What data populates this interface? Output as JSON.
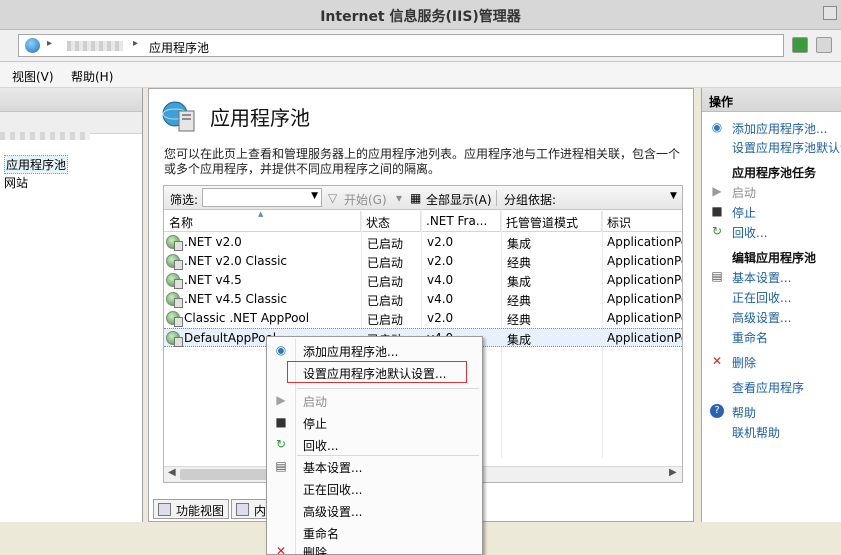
{
  "window": {
    "title": "Internet 信息服务(IIS)管理器"
  },
  "address": {
    "crumb": "应用程序池"
  },
  "menu": {
    "items": [
      "视图(V)",
      "帮助(H)"
    ]
  },
  "tree": {
    "items": [
      {
        "label": "应用程序池",
        "selected": true
      },
      {
        "label": "网站",
        "selected": false
      }
    ]
  },
  "page": {
    "title": "应用程序池",
    "description": "您可以在此页上查看和管理服务器上的应用程序池列表。应用程序池与工作进程相关联，包含一个或多个应用程序，并提供不同应用程序之间的隔离。"
  },
  "filterbar": {
    "filter_label": "筛选:",
    "start_label": "开始(G)",
    "show_all_label": "全部显示(A)",
    "group_label": "分组依据:"
  },
  "grid": {
    "columns": [
      "名称",
      "状态",
      ".NET Fra...",
      "托管管道模式",
      "标识"
    ],
    "rows": [
      {
        "name": ".NET v2.0",
        "status": "已启动",
        "net": "v2.0",
        "mode": "集成",
        "identity": "ApplicationPo"
      },
      {
        "name": ".NET v2.0 Classic",
        "status": "已启动",
        "net": "v2.0",
        "mode": "经典",
        "identity": "ApplicationPo"
      },
      {
        "name": ".NET v4.5",
        "status": "已启动",
        "net": "v4.0",
        "mode": "集成",
        "identity": "ApplicationPo"
      },
      {
        "name": ".NET v4.5 Classic",
        "status": "已启动",
        "net": "v4.0",
        "mode": "经典",
        "identity": "ApplicationPo"
      },
      {
        "name": "Classic .NET AppPool",
        "status": "已启动",
        "net": "v2.0",
        "mode": "经典",
        "identity": "ApplicationPo"
      },
      {
        "name": "DefaultAppPool",
        "status": "已启动",
        "net": "v4.0",
        "mode": "集成",
        "identity": "ApplicationPo"
      }
    ]
  },
  "viewtabs": {
    "features": "功能视图",
    "content": "内容"
  },
  "actions": {
    "header": "操作",
    "add_pool": "添加应用程序池...",
    "set_defaults": "设置应用程序池默认设置...",
    "tasks_header": "应用程序池任务",
    "start": "启动",
    "stop": "停止",
    "recycle": "回收...",
    "edit_header": "编辑应用程序池",
    "basic": "基本设置...",
    "recycling": "正在回收...",
    "advanced": "高级设置...",
    "rename": "重命名",
    "remove": "删除",
    "view_apps": "查看应用程序",
    "help": "帮助",
    "online_help": "联机帮助"
  },
  "context_menu": {
    "add_pool": "添加应用程序池...",
    "set_defaults": "设置应用程序池默认设置...",
    "start": "启动",
    "stop": "停止",
    "recycle": "回收...",
    "basic": "基本设置...",
    "recycling": "正在回收...",
    "advanced": "高级设置...",
    "rename": "重命名",
    "remove": "删除"
  }
}
